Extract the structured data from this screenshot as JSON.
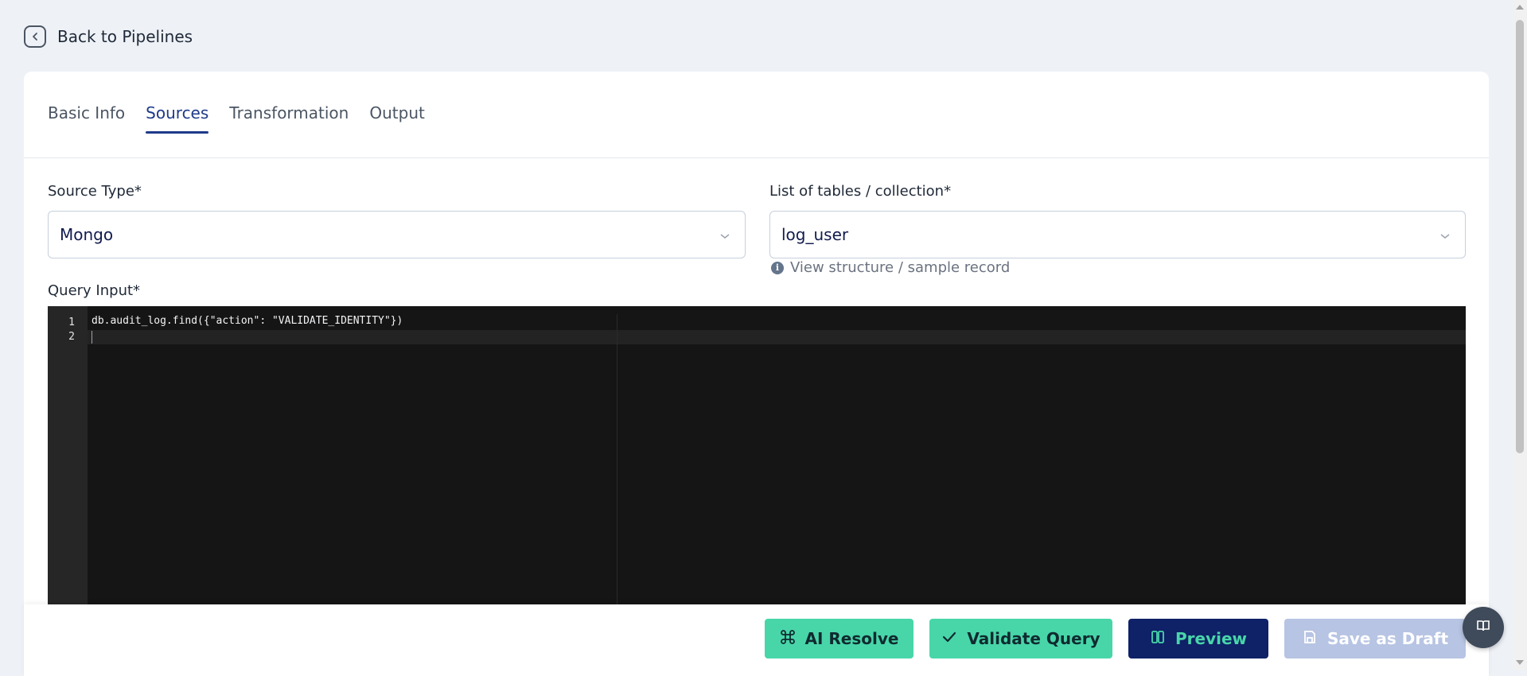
{
  "nav": {
    "back_label": "Back to Pipelines"
  },
  "tabs": [
    {
      "label": "Basic Info",
      "active": false
    },
    {
      "label": "Sources",
      "active": true
    },
    {
      "label": "Transformation",
      "active": false
    },
    {
      "label": "Output",
      "active": false
    }
  ],
  "form": {
    "source_type": {
      "label": "Source Type*",
      "value": "Mongo"
    },
    "tables": {
      "label": "List of tables / collection*",
      "value": "log_user",
      "hint": "View structure / sample record"
    },
    "query": {
      "label": "Query Input*",
      "lines": [
        {
          "number": "1",
          "text": "db.audit_log.find({\"action\": \"VALIDATE_IDENTITY\"})"
        },
        {
          "number": "2",
          "text": ""
        }
      ]
    }
  },
  "actions": {
    "ai_resolve": "AI Resolve",
    "validate_query": "Validate Query",
    "preview": "Preview",
    "save_draft": "Save as Draft"
  },
  "colors": {
    "accent_green": "#48d6a9",
    "navy": "#0f2167",
    "active_tab": "#1e3a8a",
    "disabled": "#b7c4e3",
    "editor_bg": "#151515"
  },
  "icons": {
    "back": "chevron-left-icon",
    "select": "chevron-down-icon",
    "info": "info-icon",
    "ai": "command-icon",
    "validate": "check-icon",
    "preview": "columns-icon",
    "draft": "save-icon",
    "help": "book-icon"
  }
}
